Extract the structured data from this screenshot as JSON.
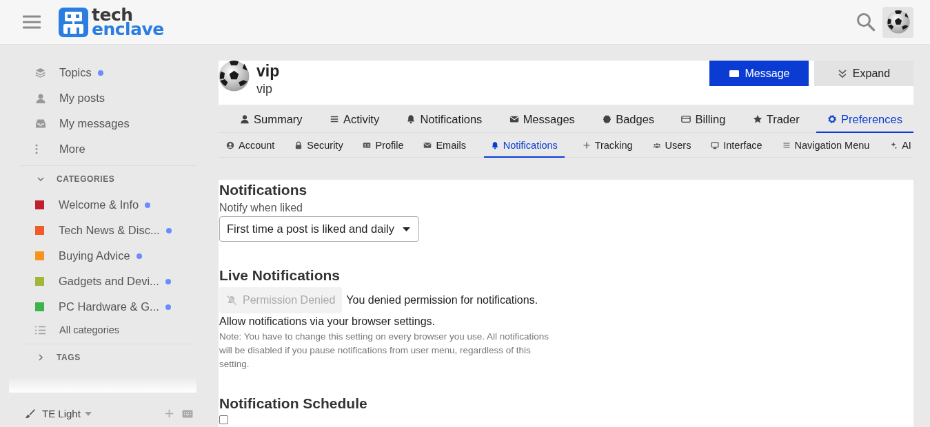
{
  "header": {
    "logo": {
      "line_1": "tech",
      "line_2": "enclave"
    }
  },
  "sidebar": {
    "nav": [
      {
        "kind": "topics",
        "label": "Topics",
        "unread": true
      },
      {
        "kind": "posts",
        "label": "My posts",
        "unread": false
      },
      {
        "kind": "messages",
        "label": "My messages",
        "unread": false
      },
      {
        "kind": "more",
        "label": "More",
        "unread": false
      }
    ],
    "categories_section": {
      "heading": "CATEGORIES",
      "expanded": true
    },
    "categories": [
      {
        "label": "Welcome & Info",
        "color": "#c11f2e",
        "unread": true
      },
      {
        "label": "Tech News & Disc...",
        "color": "#f15a29",
        "unread": true
      },
      {
        "label": "Buying Advice",
        "color": "#f7941d",
        "unread": true
      },
      {
        "label": "Gadgets and Devi...",
        "color": "#a0b737",
        "unread": true
      },
      {
        "label": "PC Hardware & G...",
        "color": "#3ab54a",
        "unread": true
      }
    ],
    "all_categories": "All categories",
    "tags_section": {
      "heading": "TAGS",
      "expanded": false
    },
    "footer": {
      "theme": "TE Light"
    }
  },
  "profile": {
    "name": "vip",
    "username": "vip",
    "buttons": [
      {
        "kind": "primary",
        "label": "Message"
      },
      {
        "kind": "secondary",
        "label": "Expand"
      }
    ]
  },
  "tabs": [
    {
      "label": "Summary",
      "selected": false
    },
    {
      "label": "Activity",
      "selected": false
    },
    {
      "label": "Notifications",
      "selected": false
    },
    {
      "label": "Messages",
      "selected": false
    },
    {
      "label": "Badges",
      "selected": false
    },
    {
      "label": "Billing",
      "selected": false
    },
    {
      "label": "Trader",
      "selected": false
    },
    {
      "label": "Preferences",
      "selected": true
    }
  ],
  "subtabs": [
    {
      "label": "Account",
      "selected": false
    },
    {
      "label": "Security",
      "selected": false
    },
    {
      "label": "Profile",
      "selected": false
    },
    {
      "label": "Emails",
      "selected": false
    },
    {
      "label": "Notifications",
      "selected": true
    },
    {
      "label": "Tracking",
      "selected": false
    },
    {
      "label": "Users",
      "selected": false
    },
    {
      "label": "Interface",
      "selected": false
    },
    {
      "label": "Navigation Menu",
      "selected": false
    },
    {
      "label": "AI",
      "selected": false
    }
  ],
  "notifications": {
    "heading": "Notifications",
    "liked_label": "Notify when liked",
    "liked_value": "First time a post is liked and daily"
  },
  "live_notifications": {
    "heading": "Live Notifications",
    "button": {
      "label": "Permission Denied",
      "disabled": true
    },
    "status": "You denied permission for notifications.",
    "hint": "Allow notifications via your browser settings.",
    "note": "Note: You have to change this setting on every browser you use. All notifications will be disabled if you pause notifications from user menu, regardless of this setting."
  },
  "schedule": {
    "heading": "Notification Schedule",
    "enable_checkbox": {
      "checked": false
    }
  }
}
